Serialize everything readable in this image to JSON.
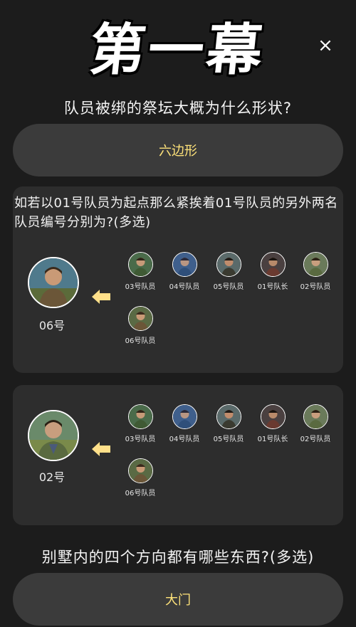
{
  "header": {
    "title": "第一幕",
    "close_label": "×"
  },
  "question1": {
    "text": "队员被绑的祭坛大概为什么形状?",
    "answer": "六边形"
  },
  "card1": {
    "question": "如若以01号队员为起点那么紧挨着01号队员的另外两名队员编号分别为?(多选)",
    "selected_label": "06号",
    "options": [
      "03号队员",
      "04号队员",
      "05号队员",
      "01号队长",
      "02号队员",
      "06号队员"
    ]
  },
  "card2": {
    "selected_label": "02号",
    "options": [
      "03号队员",
      "04号队员",
      "05号队员",
      "01号队长",
      "02号队员",
      "06号队员"
    ]
  },
  "question3": {
    "text": "别墅内的四个方向都有哪些东西?(多选)",
    "answer": "大门"
  },
  "colors": {
    "accent": "#ffe37a",
    "arrow": "#ffe08a",
    "background": "#1c1c1c",
    "card": "#2d2d2d",
    "pill": "#3b3b3b"
  },
  "icons": {
    "close": "close-icon",
    "arrow": "arrow-left-icon"
  }
}
